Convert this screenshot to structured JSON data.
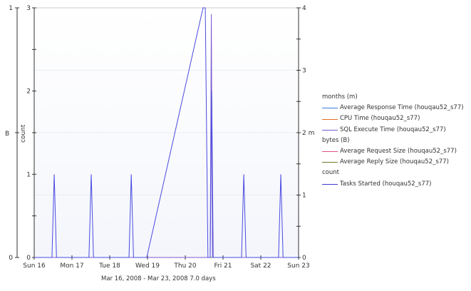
{
  "chart_data": {
    "type": "line",
    "date_range": "Mar 16, 2008 - Mar 23, 2008  7.0 days",
    "x_ticks": [
      "Sun 16",
      "Mon 17",
      "Tue 18",
      "Wed 19",
      "Thu 20",
      "Fri 21",
      "Sat 22",
      "Sun 23"
    ],
    "xlim_days": [
      0,
      7
    ],
    "axes": {
      "bytes": {
        "label": "B",
        "ylim": [
          0,
          1
        ],
        "ticks": [
          "0",
          "1"
        ]
      },
      "count": {
        "label": "count",
        "ylim": [
          0,
          3
        ],
        "ticks": [
          "0",
          "1",
          "2",
          "3"
        ]
      },
      "months": {
        "ylim": [
          0,
          4
        ],
        "ticks": [
          "0",
          "1",
          "2 m",
          "3",
          "4"
        ]
      }
    },
    "legend": [
      {
        "group": "months (m)",
        "items": [
          {
            "name": "Average Response Time (houqau52_s77)",
            "color": "#3a7be0"
          },
          {
            "name": "CPU Time (houqau52_s77)",
            "color": "#e07020"
          },
          {
            "name": "SQL Execute Time (houqau52_s77)",
            "color": "#7a5ad0"
          }
        ]
      },
      {
        "group": "bytes (B)",
        "items": [
          {
            "name": "Average Request Size (houqau52_s77)",
            "color": "#e0508a"
          },
          {
            "name": "Average Reply Size (houqau52_s77)",
            "color": "#6a7a2a"
          }
        ]
      },
      {
        "group": "count",
        "items": [
          {
            "name": "Tasks Started (houqau52_s77)",
            "color": "#3a3ad0"
          }
        ]
      }
    ],
    "series": [
      {
        "name": "Tasks Started (houqau52_s77)",
        "axis": "count",
        "color": "#4a4ae0",
        "x": [
          0,
          0.47,
          0.53,
          0.59,
          1.45,
          1.51,
          1.57,
          2.51,
          2.57,
          2.63,
          2.98,
          4.47,
          4.53,
          4.6,
          4.66,
          4.7,
          4.74,
          5.49,
          5.55,
          5.61,
          6.47,
          6.53,
          6.59,
          7
        ],
        "y": [
          0,
          0,
          1,
          0,
          0,
          1,
          0,
          0,
          1,
          0,
          0,
          3,
          3,
          0,
          0,
          2,
          0,
          0,
          1,
          0,
          0,
          1,
          0,
          0
        ]
      },
      {
        "name": "SQL Execute Time (houqau52_s77)",
        "axis": "months",
        "color": "#7a5ad0",
        "x": [
          0,
          4.66,
          4.69,
          4.72,
          7
        ],
        "y": [
          0,
          0,
          3.9,
          0,
          0
        ]
      },
      {
        "name": "Average Reply Size (houqau52_s77)",
        "axis": "bytes",
        "color": "#6a7a2a",
        "x": [
          0,
          7
        ],
        "y": [
          0,
          0
        ]
      }
    ]
  }
}
